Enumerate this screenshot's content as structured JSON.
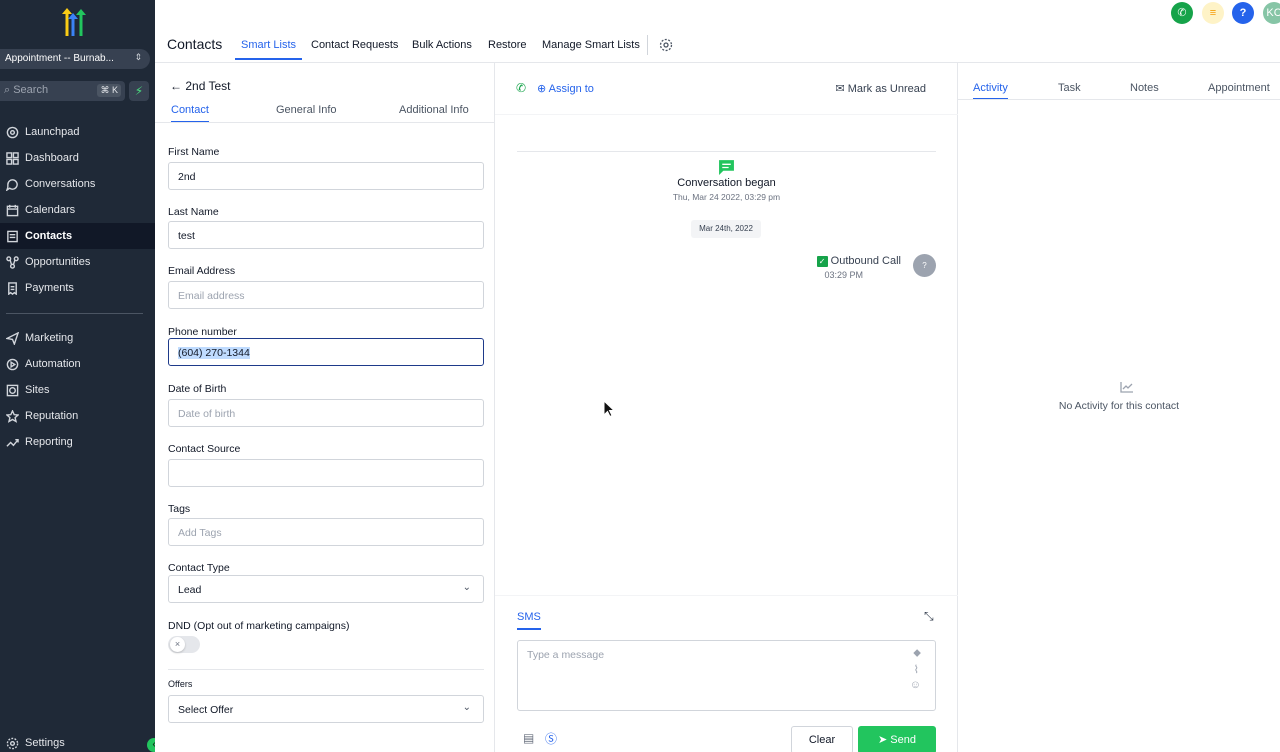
{
  "sidebar": {
    "location": "Appointment -- Burnab...",
    "search": {
      "placeholder": "Search",
      "shortcut": "⌘ K"
    },
    "items": [
      {
        "label": "Launchpad",
        "icon": "rocket-icon"
      },
      {
        "label": "Dashboard",
        "icon": "grid-icon"
      },
      {
        "label": "Conversations",
        "icon": "chat-icon"
      },
      {
        "label": "Calendars",
        "icon": "calendar-icon"
      },
      {
        "label": "Contacts",
        "icon": "contact-card-icon",
        "active": true
      },
      {
        "label": "Opportunities",
        "icon": "funnel-icon"
      },
      {
        "label": "Payments",
        "icon": "receipt-icon"
      },
      {
        "label": "Marketing",
        "icon": "send-icon"
      },
      {
        "label": "Automation",
        "icon": "automation-icon"
      },
      {
        "label": "Sites",
        "icon": "globe-icon"
      },
      {
        "label": "Reputation",
        "icon": "star-icon"
      },
      {
        "label": "Reporting",
        "icon": "trend-icon"
      }
    ],
    "settings": "Settings"
  },
  "topbar": {
    "title": "Contacts",
    "tabs": [
      "Smart Lists",
      "Contact Requests",
      "Bulk Actions",
      "Restore",
      "Manage Smart Lists"
    ],
    "active_tab": "Smart Lists",
    "avatar_initials": "KC"
  },
  "contact": {
    "back_label": "2nd Test",
    "tabs": [
      "Contact",
      "General Info",
      "Additional Info"
    ],
    "fields": {
      "first_name": {
        "label": "First Name",
        "value": "2nd"
      },
      "last_name": {
        "label": "Last Name",
        "value": "test"
      },
      "email": {
        "label": "Email Address",
        "placeholder": "Email address"
      },
      "phone": {
        "label": "Phone number",
        "value": "(604) 270-1344"
      },
      "dob": {
        "label": "Date of Birth",
        "placeholder": "Date of birth"
      },
      "source": {
        "label": "Contact Source",
        "value": ""
      },
      "tags": {
        "label": "Tags",
        "placeholder": "Add Tags"
      },
      "type": {
        "label": "Contact Type",
        "value": "Lead"
      },
      "dnd": {
        "label": "DND (Opt out of marketing campaigns)"
      },
      "offers": {
        "label": "Offers",
        "value": "Select Offer"
      }
    }
  },
  "conversation": {
    "assign": "Assign to",
    "mark_unread": "Mark as Unread",
    "began": "Conversation began",
    "began_date": "Thu, Mar 24 2022, 03:29 pm",
    "date_chip": "Mar 24th, 2022",
    "call_label": "Outbound Call",
    "call_time": "03:29 PM",
    "sms_tab": "SMS",
    "message_placeholder": "Type a message",
    "clear": "Clear",
    "send": "Send"
  },
  "activity": {
    "tabs": [
      "Activity",
      "Task",
      "Notes",
      "Appointment"
    ],
    "empty": "No Activity for this contact"
  },
  "colors": {
    "accent": "#2563eb",
    "sidebar": "#1f2937",
    "success": "#22c55e"
  }
}
